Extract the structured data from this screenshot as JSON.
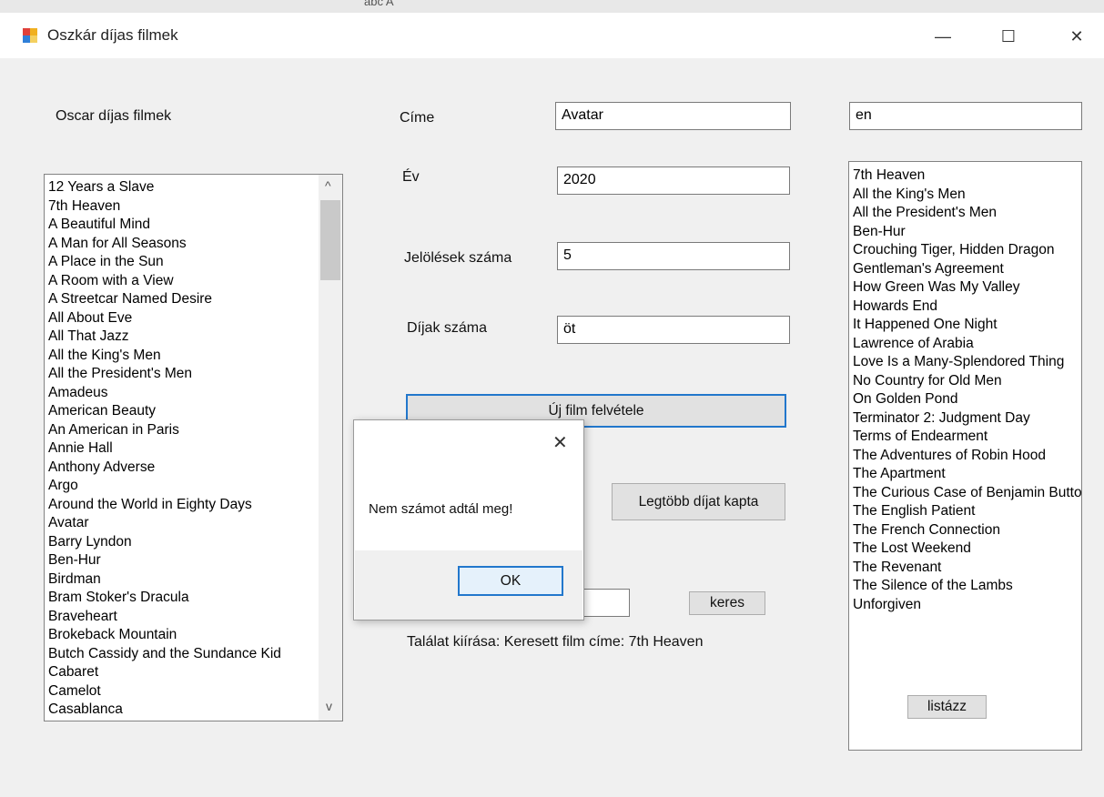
{
  "window": {
    "title": "Oszkár díjas filmek",
    "controls": {
      "minimize": "—",
      "maximize": "☐",
      "close": "✕"
    },
    "background_strip": "abc   A"
  },
  "left_panel": {
    "heading": "Oscar díjas filmek",
    "films": [
      "12 Years a Slave",
      "7th Heaven",
      "A Beautiful Mind",
      "A Man for All Seasons",
      "A Place in the Sun",
      "A Room with a View",
      "A Streetcar Named Desire",
      "All About Eve",
      "All That Jazz",
      "All the King's Men",
      "All the President's Men",
      "Amadeus",
      "American Beauty",
      "An American in Paris",
      "Annie Hall",
      "Anthony Adverse",
      "Argo",
      "Around the World in Eighty Days",
      "Avatar",
      "Barry Lyndon",
      "Ben-Hur",
      "Birdman",
      "Bram Stoker's Dracula",
      "Braveheart",
      "Brokeback Mountain",
      "Butch Cassidy and the Sundance Kid",
      "Cabaret",
      "Camelot",
      "Casablanca"
    ]
  },
  "form": {
    "title_label": "Címe",
    "title_value": "Avatar",
    "year_label": "Év",
    "year_value": "2020",
    "nominations_label": "Jelölések száma",
    "nominations_value": "5",
    "awards_label": "Díjak száma",
    "awards_value": "öt",
    "add_button": "Új film felvétele",
    "most_awards_button": "Legtöbb díjat kapta",
    "search_value": "",
    "search_button": "keres",
    "result_text": "Találat kiírása: Keresett film címe: 7th Heaven"
  },
  "right_panel": {
    "filter_value": "en",
    "results": [
      "7th Heaven",
      "All the King's Men",
      "All the President's Men",
      "Ben-Hur",
      "Crouching Tiger, Hidden Dragon",
      "Gentleman's Agreement",
      "How Green Was My Valley",
      "Howards End",
      "It Happened One Night",
      "Lawrence of Arabia",
      "Love Is a Many-Splendored Thing",
      "No Country for Old Men",
      "On Golden Pond",
      "Terminator 2: Judgment Day",
      "Terms of Endearment",
      "The Adventures of Robin Hood",
      "The Apartment",
      "The Curious Case of Benjamin Button",
      "The English Patient",
      "The French Connection",
      "The Lost Weekend",
      "The Revenant",
      "The Silence of the Lambs",
      "Unforgiven"
    ],
    "list_button": "listázz"
  },
  "dialog": {
    "message": "Nem számot adtál meg!",
    "ok_button": "OK",
    "close": "✕"
  },
  "scroll_arrows": {
    "up": "^",
    "down": "v"
  }
}
